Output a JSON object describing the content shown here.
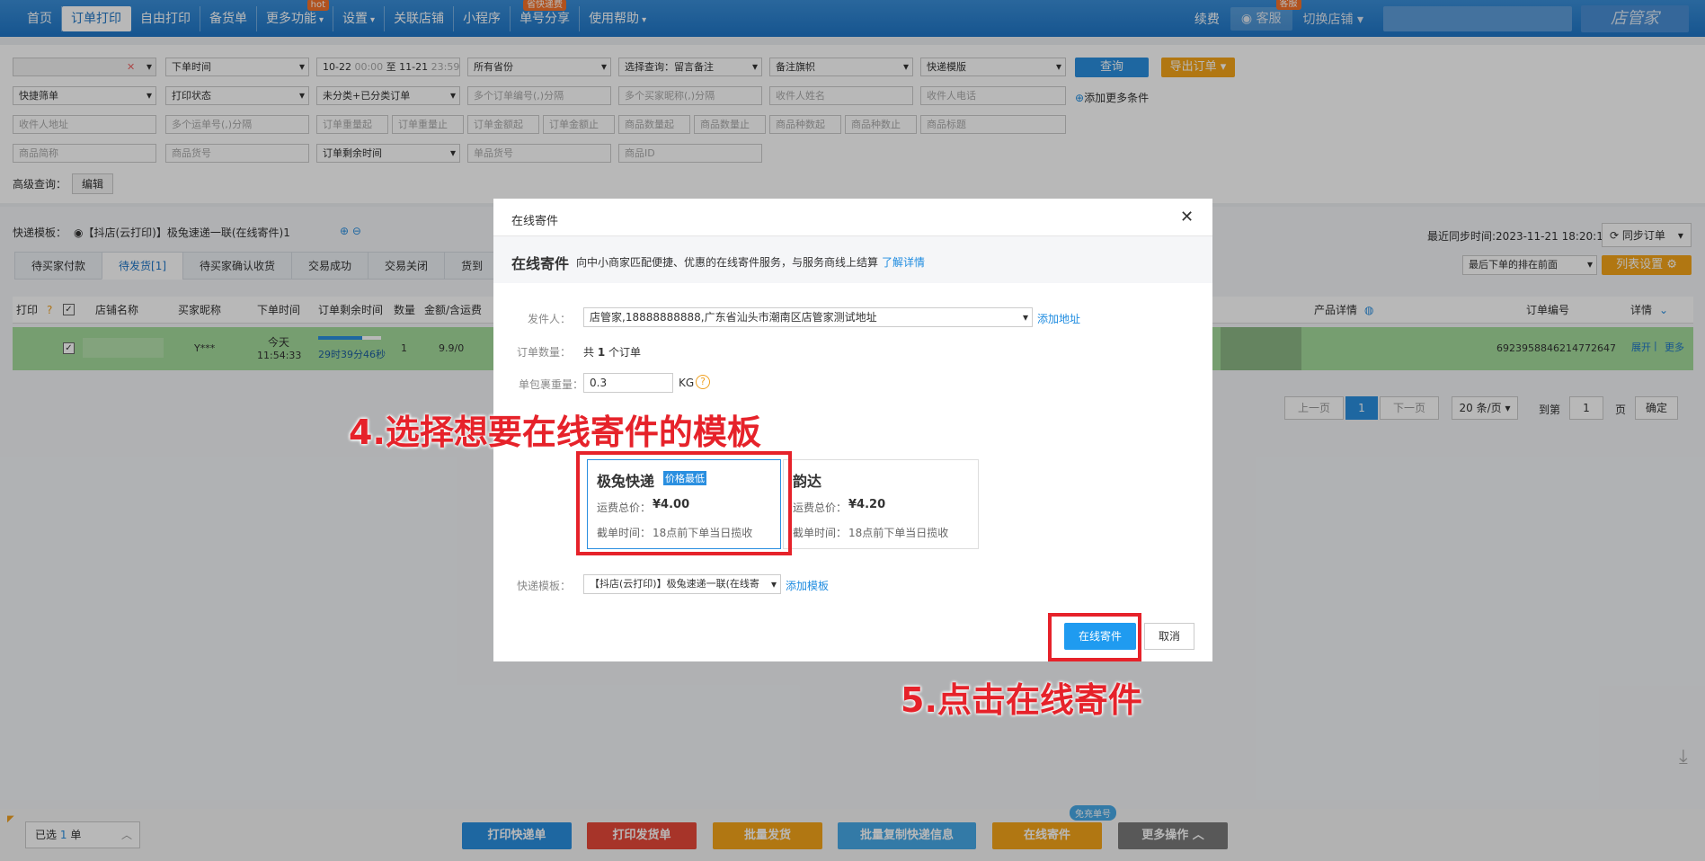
{
  "nav": {
    "items": [
      {
        "label": "首页",
        "active": false
      },
      {
        "label": "订单打印",
        "active": true
      },
      {
        "label": "自由打印",
        "active": false
      },
      {
        "label": "备货单",
        "active": false
      },
      {
        "label": "更多功能",
        "active": false,
        "badge": "hot",
        "caret": "▾"
      },
      {
        "label": "设置",
        "active": false,
        "caret": "▾"
      },
      {
        "label": "关联店铺",
        "active": false
      },
      {
        "label": "小程序",
        "active": false
      },
      {
        "label": "单号分享",
        "active": false,
        "badge": "省快递费"
      },
      {
        "label": "使用帮助",
        "active": false,
        "caret": "▾"
      }
    ],
    "right": {
      "renew": "续费",
      "service": "客服",
      "service_badge": "客服",
      "switch_shop": "切换店铺",
      "brand": "店管家"
    }
  },
  "filters": {
    "row1": [
      "下单时间",
      "10-22",
      "00:00",
      "至",
      "11-21",
      "23:59",
      "所有省份",
      "选择查询：留言备注",
      "备注旗帜",
      "快递模版"
    ],
    "row2": [
      "快捷筛单",
      "打印状态",
      "未分类+已分类订单",
      "多个订单编号(,)分隔",
      "多个买家昵称(,)分隔",
      "收件人姓名",
      "收件人电话",
      "添加更多条件"
    ],
    "row3": [
      "收件人地址",
      "多个运单号(,)分隔",
      "订单重量起",
      "订单重量止",
      "订单金额起",
      "订单金额止",
      "商品数量起",
      "商品数量止",
      "商品种数起",
      "商品种数止",
      "商品标题"
    ],
    "row4": [
      "商品简称",
      "商品货号",
      "订单剩余时间",
      "单品货号",
      "商品ID"
    ],
    "query": "查询",
    "export": "导出订单 ▾",
    "advanced_label": "高级查询：",
    "edit": "编辑"
  },
  "template_bar": {
    "label": "快递模板：",
    "value": "【抖店(云打印)】极兔速递一联(在线寄件)1",
    "sync_time": "最近同步时间:2023-11-21 18:20:13",
    "sync_btn": "同步订单",
    "sort": "最后下单的排在前面",
    "list_settings": "列表设置"
  },
  "tabs": [
    "待买家付款",
    "待发货[1]",
    "待买家确认收货",
    "交易成功",
    "交易关闭",
    "货到"
  ],
  "table": {
    "headers": [
      "打印",
      "店铺名称",
      "买家昵称",
      "下单时间",
      "订单剩余时间",
      "数量",
      "金额/含运费",
      "产品详情",
      "订单编号",
      "详情"
    ],
    "row": {
      "buyer": "Y***",
      "date": "今天",
      "time": "11:54:33",
      "remaining": "29时39分46秒",
      "remaining_fraction": 0.7,
      "qty": "1",
      "amount": "9.9/0",
      "order_no": "6923958846214772647",
      "expand": "展开",
      "more": "更多"
    }
  },
  "pager": {
    "prev": "上一页",
    "page": "1",
    "next": "下一页",
    "per_page": "20 条/页",
    "goto": "到第",
    "page_input": "1",
    "page_unit": "页",
    "confirm": "确定"
  },
  "modal": {
    "title": "在线寄件",
    "subtitle": "在线寄件",
    "desc": "向中小商家匹配便捷、优惠的在线寄件服务，与服务商线上结算",
    "learn_more": "了解详情",
    "sender_label": "发件人：",
    "sender_value": "店管家,18888888888,广东省汕头市潮南区店管家测试地址",
    "add_address": "添加地址",
    "order_count_label": "订单数量：",
    "order_count_prefix": "共",
    "order_count": "1",
    "order_count_suffix": "个订单",
    "weight_label": "单包裹重量：",
    "weight_value": "0.3",
    "weight_unit": "KG",
    "couriers": [
      {
        "name": "极兔快递",
        "tag": "价格最低",
        "price_label": "运费总价：",
        "price": "¥4.00",
        "cutoff_label": "截单时间：",
        "cutoff": "18点前下单当日揽收",
        "selected": true
      },
      {
        "name": "韵达",
        "tag": "",
        "price_label": "运费总价：",
        "price": "¥4.20",
        "cutoff_label": "截单时间：",
        "cutoff": "18点前下单当日揽收",
        "selected": false
      }
    ],
    "template_label": "快递模板：",
    "template_value": "【抖店(云打印)】极兔速递一联(在线寄",
    "add_template": "添加模板",
    "submit": "在线寄件",
    "cancel": "取消"
  },
  "annotations": {
    "step4": "4.选择想要在线寄件的模板",
    "step5": "5.点击在线寄件"
  },
  "bottom": {
    "selected_prefix": "已选",
    "selected_count": "1",
    "selected_suffix": "单",
    "free_badge": "免充单号",
    "buttons": [
      {
        "label": "打印快递单",
        "color": "#2a8fe0"
      },
      {
        "label": "打印发货单",
        "color": "#e8493a"
      },
      {
        "label": "批量发货",
        "color": "#f6a51a"
      },
      {
        "label": "批量复制快递信息",
        "color": "#47a9e8"
      },
      {
        "label": "在线寄件",
        "color": "#f6a51a"
      },
      {
        "label": "更多操作 ︿",
        "color": "#7a7a7a"
      }
    ]
  },
  "colors": {
    "brand": "#1f76c7",
    "accent": "#2a8fe0",
    "highlight_row": "#a4dc9c",
    "annotation": "#e6222a"
  }
}
